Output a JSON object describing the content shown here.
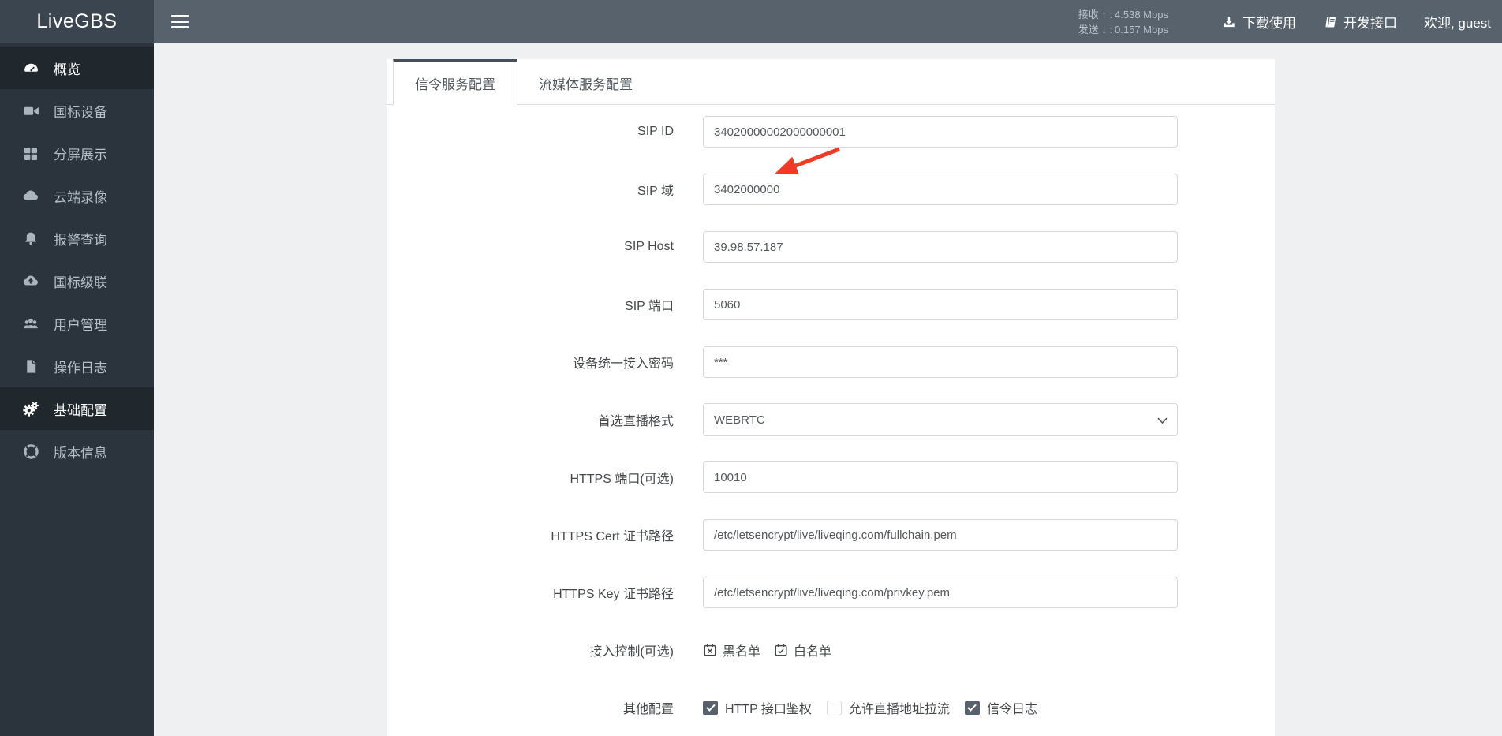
{
  "topbar": {
    "brand": "LiveGBS",
    "stats": {
      "recv_label": "接收",
      "recv_arrow": "↑",
      "recv_value": "4.538 Mbps",
      "send_label": "发送",
      "send_arrow": "↓",
      "send_value": "0.157 Mbps"
    },
    "download_label": "下载使用",
    "api_label": "开发接口",
    "welcome": "欢迎, guest"
  },
  "sidebar": {
    "items": [
      {
        "label": "概览",
        "icon": "dashboard-icon",
        "active": true
      },
      {
        "label": "国标设备",
        "icon": "camera-icon",
        "active": false
      },
      {
        "label": "分屏展示",
        "icon": "grid-icon",
        "active": false
      },
      {
        "label": "云端录像",
        "icon": "cloud-icon",
        "active": false
      },
      {
        "label": "报警查询",
        "icon": "bell-icon",
        "active": false
      },
      {
        "label": "国标级联",
        "icon": "cloud-upload-icon",
        "active": false
      },
      {
        "label": "用户管理",
        "icon": "users-icon",
        "active": false
      },
      {
        "label": "操作日志",
        "icon": "file-icon",
        "active": false
      },
      {
        "label": "基础配置",
        "icon": "gears-icon",
        "active": true
      },
      {
        "label": "版本信息",
        "icon": "life-ring-icon",
        "active": false
      }
    ]
  },
  "tabs": [
    {
      "label": "信令服务配置",
      "active": true
    },
    {
      "label": "流媒体服务配置",
      "active": false
    }
  ],
  "form": {
    "fields": [
      {
        "label": "SIP ID",
        "value": "34020000002000000001",
        "type": "input"
      },
      {
        "label": "SIP 域",
        "value": "3402000000",
        "type": "input"
      },
      {
        "label": "SIP Host",
        "value": "39.98.57.187",
        "type": "input"
      },
      {
        "label": "SIP 端口",
        "value": "5060",
        "type": "input"
      },
      {
        "label": "设备统一接入密码",
        "value": "***",
        "type": "input"
      },
      {
        "label": "首选直播格式",
        "value": "WEBRTC",
        "type": "select"
      },
      {
        "label": "HTTPS 端口(可选)",
        "value": "10010",
        "type": "input"
      },
      {
        "label": "HTTPS Cert 证书路径",
        "value": "/etc/letsencrypt/live/liveqing.com/fullchain.pem",
        "type": "input"
      },
      {
        "label": "HTTPS Key 证书路径",
        "value": "/etc/letsencrypt/live/liveqing.com/privkey.pem",
        "type": "input"
      }
    ],
    "access_control": {
      "label": "接入控制(可选)",
      "buttons": [
        {
          "label": "黑名单",
          "icon": "calendar-times-icon"
        },
        {
          "label": "白名单",
          "icon": "calendar-check-icon"
        }
      ]
    },
    "other_config": {
      "label": "其他配置",
      "checkboxes": [
        {
          "label": "HTTP 接口鉴权",
          "checked": true
        },
        {
          "label": "允许直播地址拉流",
          "checked": false
        },
        {
          "label": "信令日志",
          "checked": true
        }
      ]
    }
  },
  "annotation": {
    "type": "red-arrow",
    "points_at": "SIP 域 input"
  },
  "colors": {
    "topbar_bg": "#57626c",
    "brand_bg": "#3b454f",
    "sidebar_bg": "#2b343c",
    "sidebar_active_bg": "#20272d",
    "page_bg": "#eef0f1",
    "tab_active_border": "#454f59",
    "checkbox_checked": "#59626c",
    "annotation_red": "#ef3b25"
  }
}
